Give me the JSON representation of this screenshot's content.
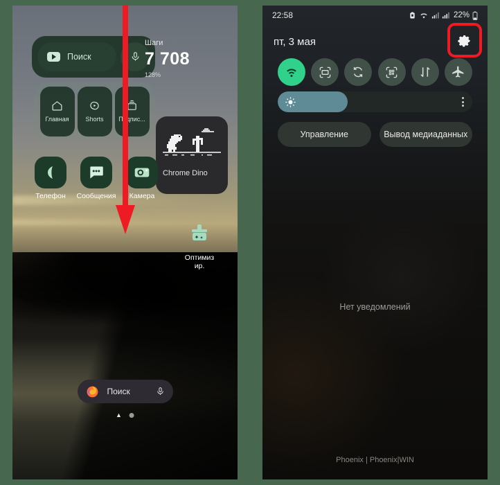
{
  "frame": {
    "border_color": "#47684f"
  },
  "left_panel": {
    "name": "home-screen",
    "youtube_widget": {
      "search_label": "Поиск",
      "mic_icon": "microphone-icon",
      "logo_icon": "youtube-icon"
    },
    "youtube_shortcuts": [
      {
        "label": "Главная",
        "icon": "home-icon"
      },
      {
        "label": "Shorts",
        "icon": "shorts-icon"
      },
      {
        "label": "Подпис...",
        "icon": "subscriptions-icon"
      }
    ],
    "steps_widget": {
      "title": "Шаги",
      "value": "7 708",
      "percent": "128%"
    },
    "dino_widget": {
      "caption": "Chrome Dino",
      "icon": "dino-icon"
    },
    "apps": [
      {
        "label": "Телефон",
        "icon": "phone-icon"
      },
      {
        "label": "Сообщения",
        "icon": "messages-icon"
      },
      {
        "label": "Камера",
        "icon": "camera-icon"
      }
    ],
    "optimizer": {
      "label": "Оптимизир.",
      "label_line1": "Оптимиз",
      "label_line2": "ир.",
      "icon": "broom-icon"
    },
    "firefox_search": {
      "placeholder": "Поиск",
      "logo_icon": "firefox-icon",
      "mic_icon": "microphone-icon"
    },
    "page_dots": {
      "count": 2,
      "active_index": 0
    },
    "gesture_arrow": {
      "icon": "down-arrow-icon",
      "color": "#ee1b25"
    }
  },
  "right_panel": {
    "name": "quick-settings-panel",
    "statusbar": {
      "time": "22:58",
      "icons": [
        "alarm-icon",
        "wifi-icon",
        "signal-icon",
        "signal-2-icon"
      ],
      "battery_percent": "22%"
    },
    "header": {
      "date": "пт, 3 мая",
      "settings_icon": "gear-icon",
      "highlight_color": "#ee1b25"
    },
    "toggles": [
      {
        "name": "wifi-toggle",
        "icon": "wifi-icon",
        "active": true
      },
      {
        "name": "smart-view-toggle",
        "icon": "smart-view-icon",
        "active": false
      },
      {
        "name": "auto-rotate-toggle",
        "icon": "auto-rotate-icon",
        "active": false
      },
      {
        "name": "qr-scanner-toggle",
        "icon": "qr-scan-icon",
        "active": false
      },
      {
        "name": "mobile-data-toggle",
        "icon": "data-transfer-icon",
        "active": false
      },
      {
        "name": "airplane-mode-toggle",
        "icon": "airplane-icon",
        "active": false
      }
    ],
    "brightness": {
      "icon": "brightness-icon",
      "value_percent": 36,
      "fill_color": "#5f8b96",
      "menu_icon": "kebab-menu-icon"
    },
    "buttons": [
      {
        "name": "device-control-button",
        "label": "Управление"
      },
      {
        "name": "media-output-button",
        "label": "Вывод медиаданных"
      }
    ],
    "notifications": {
      "empty_text": "Нет уведомлений"
    },
    "footer": "Phoenix | Phoenix|WIN"
  }
}
